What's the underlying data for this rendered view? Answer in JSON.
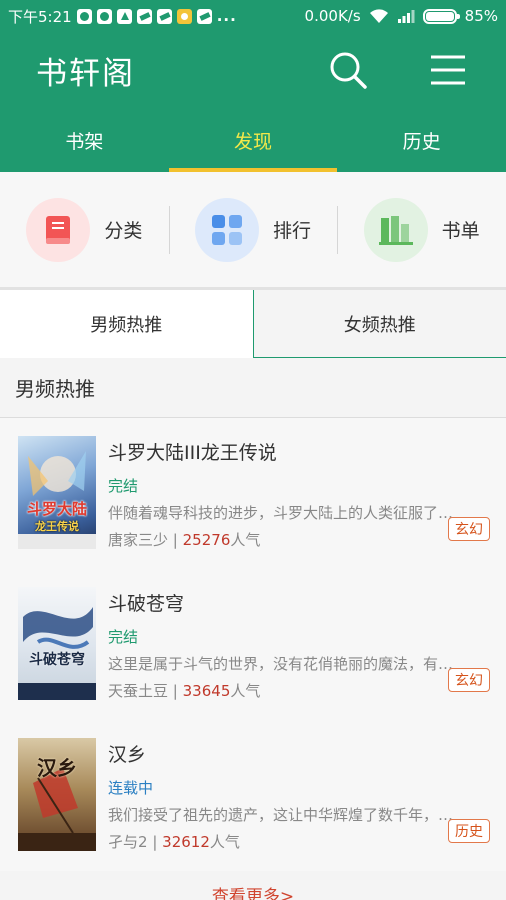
{
  "status": {
    "time": "下午5:21",
    "dots": "...",
    "speed": "0.00K/s",
    "battery": "85%"
  },
  "app": {
    "title": "书轩阁"
  },
  "main_tabs": [
    "书架",
    "发现",
    "历史"
  ],
  "categories": [
    {
      "label": "分类",
      "icon": "book-icon",
      "color": "#f25555"
    },
    {
      "label": "排行",
      "icon": "grid-icon",
      "color": "#4a8ee8"
    },
    {
      "label": "书单",
      "icon": "bars-icon",
      "color": "#5cb85c"
    }
  ],
  "sub_tabs": [
    "男频热推",
    "女频热推"
  ],
  "section_title": "男频热推",
  "books": [
    {
      "title": "斗罗大陆III龙王传说",
      "status": "完结",
      "desc": "伴随着魂导科技的进步，斗罗大陆上的人类征服了…",
      "author": "唐家三少",
      "separator": "|",
      "popularity": "25276",
      "pop_suffix": "人气",
      "tag": "玄幻",
      "cover_text": "斗罗大陆",
      "cover_sub": "龙王传说"
    },
    {
      "title": "斗破苍穹",
      "status": "完结",
      "desc": "这里是属于斗气的世界，没有花俏艳丽的魔法，有…",
      "author": "天蚕土豆",
      "separator": "|",
      "popularity": "33645",
      "pop_suffix": "人气",
      "tag": "玄幻",
      "cover_text": "斗破苍穹",
      "cover_sub": ""
    },
    {
      "title": "汉乡",
      "status": "连载中",
      "desc": "我们接受了祖先的遗产，这让中华辉煌了数千年，…",
      "author": "孑与2",
      "separator": "|",
      "popularity": "32612",
      "pop_suffix": "人气",
      "tag": "历史",
      "cover_text": "汉乡",
      "cover_sub": ""
    }
  ],
  "more_label": "查看更多>",
  "colors": {
    "primary": "#1f9a6f",
    "active_tab": "#f3e84a",
    "indicator": "#f2c12e",
    "popularity": "#c0392b",
    "tag": "#d5531b"
  }
}
